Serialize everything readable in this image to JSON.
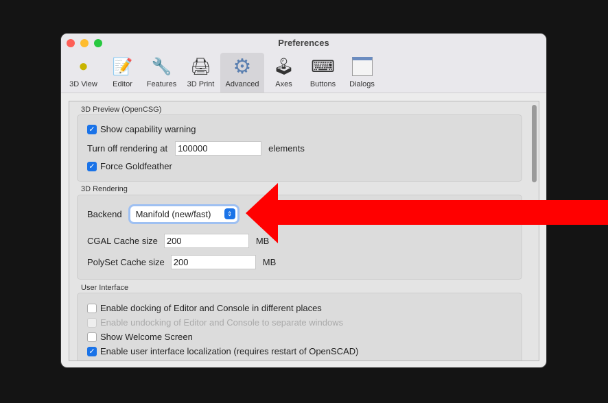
{
  "window": {
    "title": "Preferences"
  },
  "toolbar": {
    "items": [
      {
        "label": "3D View",
        "icon": "3d-view-icon"
      },
      {
        "label": "Editor",
        "icon": "editor-icon"
      },
      {
        "label": "Features",
        "icon": "features-icon"
      },
      {
        "label": "3D Print",
        "icon": "printer-icon"
      },
      {
        "label": "Advanced",
        "icon": "gear-icon",
        "selected": true
      },
      {
        "label": "Axes",
        "icon": "joystick-icon"
      },
      {
        "label": "Buttons",
        "icon": "keyboard-icon"
      },
      {
        "label": "Dialogs",
        "icon": "window-icon"
      }
    ]
  },
  "preview": {
    "title": "3D Preview (OpenCSG)",
    "show_capability_warning": "Show capability warning",
    "turn_off_label": "Turn off rendering at",
    "turn_off_value": "100000",
    "turn_off_unit": "elements",
    "force_goldfeather": "Force Goldfeather"
  },
  "rendering": {
    "title": "3D Rendering",
    "backend_label": "Backend",
    "backend_value": "Manifold (new/fast)",
    "cgal_label": "CGAL Cache size",
    "cgal_value": "200",
    "cgal_unit": "MB",
    "polyset_label": "PolySet Cache size",
    "polyset_value": "200",
    "polyset_unit": "MB"
  },
  "ui": {
    "title": "User Interface",
    "items": [
      {
        "label": "Enable docking of Editor and Console in different places",
        "checked": false
      },
      {
        "label": "Enable undocking of Editor and Console to separate windows",
        "checked": false,
        "disabled": true
      },
      {
        "label": "Show Welcome Screen",
        "checked": false
      },
      {
        "label": "Enable user interface localization (requires restart of OpenSCAD)",
        "checked": true
      }
    ]
  },
  "annotation": {
    "arrow_color": "#ff0000"
  }
}
